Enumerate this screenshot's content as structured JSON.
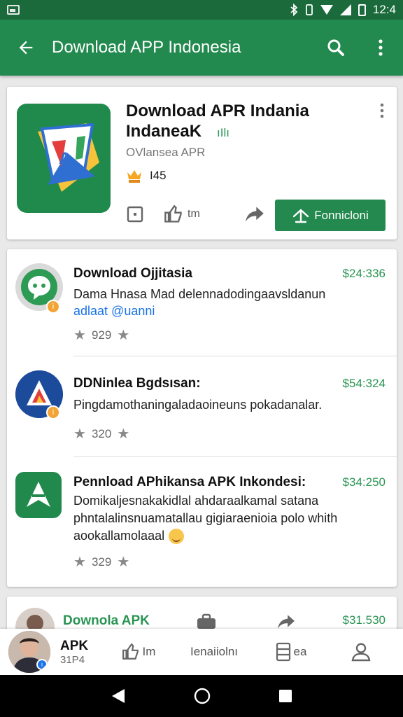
{
  "status_bar": {
    "time": "12:4"
  },
  "app_bar": {
    "title": "Download APP Indonesia"
  },
  "hero": {
    "title_line1": "Download APR Indania",
    "title_line2": "IndaneaK",
    "verified_label": "ıIlı",
    "developer": "OVlansea APR",
    "rating": "I45",
    "likes": "tm",
    "install_label": "Fonnicloni"
  },
  "list": {
    "items": [
      {
        "title": "Download Ojjitasia",
        "price": "$24:336",
        "desc": "Dama Hnasa Mad delennadodingaavsldanun",
        "link": "adlaat @uanni",
        "rating": "929"
      },
      {
        "title": "DDNinlea Bgdsısan:",
        "price": "$54:324",
        "desc": "Pingdamothaningaladaoineuns pokadanalar.",
        "rating": "320"
      },
      {
        "title": "Pennload APhikansa APK Inkondesi:",
        "price": "$34:250",
        "desc": "Domikaljesnakakidlal ahdaraalkamal satana phntalalinsnuamatallau gigiaraenioia polo whith aookallamolaaal",
        "rating": "329"
      }
    ]
  },
  "partial": {
    "title": "Downola APK",
    "price": "$31.530"
  },
  "bottom_nav": {
    "profile_name": "APK",
    "profile_sub": "31P4",
    "item2_label": "Im",
    "item3_label": "Ienaiiolnı",
    "item4_label": "ea"
  },
  "colors": {
    "primary": "#238a4f",
    "primary_dark": "#1b6a3c",
    "price_green": "#2a9454",
    "link_blue": "#1a73e8"
  }
}
